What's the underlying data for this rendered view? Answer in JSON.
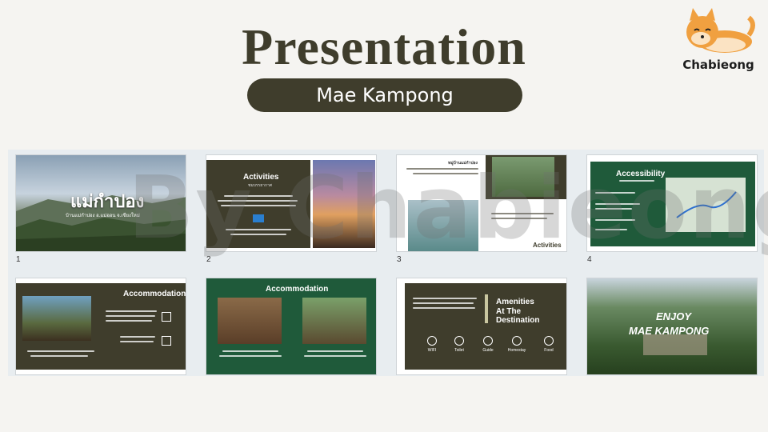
{
  "header": {
    "title": "Presentation",
    "subtitle": "Mae Kampong"
  },
  "brand": {
    "name": "Chabieong"
  },
  "watermark": "By Chabieong",
  "slides": [
    {
      "number": "1",
      "heading": "แม่กำปอง",
      "sub": "บ้านแม่กำปอง อ.แม่ออน จ.เชียงใหม่"
    },
    {
      "number": "2",
      "heading": "Activities",
      "sub": "ชมบรรยากาศ"
    },
    {
      "number": "3",
      "heading": "หมู่บ้านแม่กำปอง",
      "footer": "Activities"
    },
    {
      "number": "4",
      "heading": "Accessibility"
    },
    {
      "number": "",
      "heading": "Accommodation"
    },
    {
      "number": "",
      "heading": "Accommodation"
    },
    {
      "number": "",
      "heading": "Amenities",
      "heading2": "At The Destination",
      "amenities": [
        "WIFI",
        "Toilet",
        "Guide",
        "Homestay",
        "Food"
      ]
    },
    {
      "number": "",
      "heading": "ENJOY",
      "heading2": "MAE KAMPONG"
    }
  ],
  "colors": {
    "dark_olive": "#3f3d2c",
    "forest_green": "#1f5a3a",
    "strip": "#e8edf0"
  }
}
